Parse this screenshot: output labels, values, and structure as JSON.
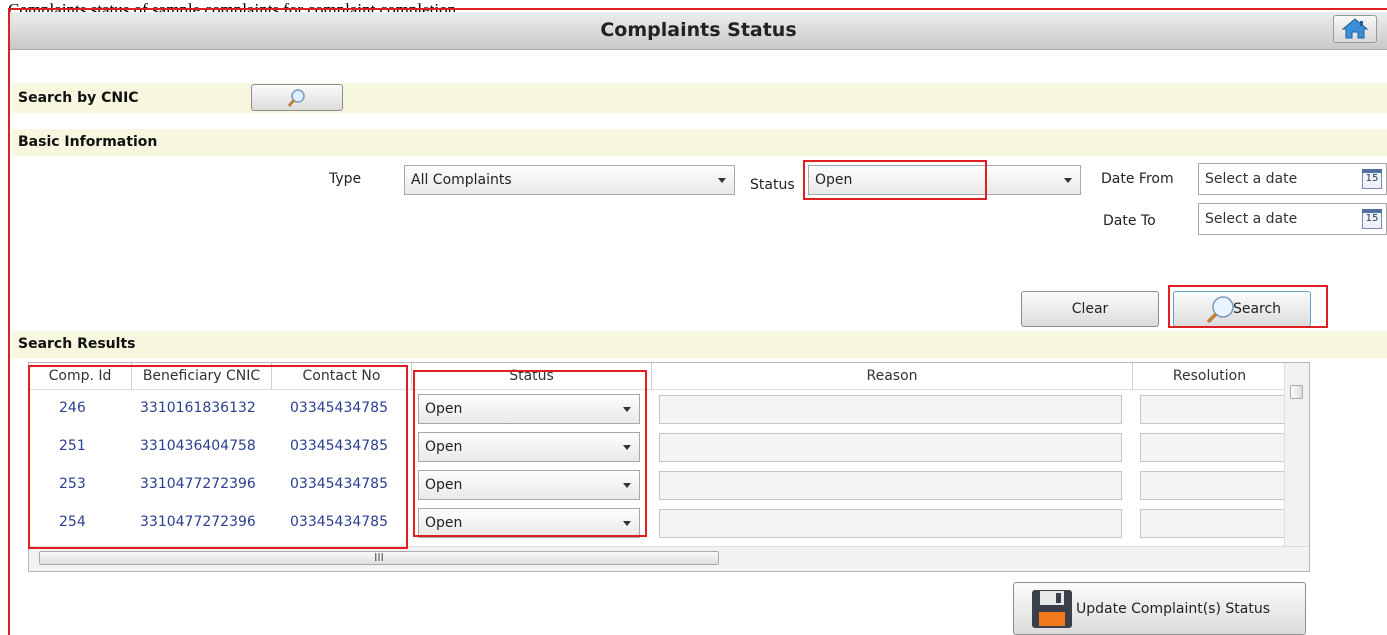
{
  "caption": "Complaints status of sample complaints for complaint completion",
  "window": {
    "title": "Complaints Status",
    "home_icon": "home-icon"
  },
  "search_cnic": {
    "label": "Search by CNIC",
    "icon": "magnifier-icon"
  },
  "basic_info": {
    "heading": "Basic Information",
    "type_label": "Type",
    "type_value": "All Complaints",
    "status_label": "Status",
    "status_value": "Open",
    "date_from_label": "Date From",
    "date_from_placeholder": "Select a date",
    "date_to_label": "Date To",
    "date_to_placeholder": "Select a date",
    "calendar_day": "15"
  },
  "actions": {
    "clear_label": "Clear",
    "search_label": "Search"
  },
  "results": {
    "heading": "Search Results",
    "columns": [
      "Comp. Id",
      "Beneficiary CNIC",
      "Contact No",
      "Status",
      "Reason",
      "Resolution"
    ],
    "rows": [
      {
        "id": "246",
        "cnic": "3310161836132",
        "contact": "03345434785",
        "status": "Open"
      },
      {
        "id": "251",
        "cnic": "3310436404758",
        "contact": "03345434785",
        "status": "Open"
      },
      {
        "id": "253",
        "cnic": "3310477272396",
        "contact": "03345434785",
        "status": "Open"
      },
      {
        "id": "254",
        "cnic": "3310477272396",
        "contact": "03345434785",
        "status": "Open"
      }
    ],
    "hscroll_grip": "III"
  },
  "update_button": {
    "label": "Update Complaint(s) Status",
    "icon": "floppy-disk-icon"
  },
  "colors": {
    "highlight": "#e02020",
    "section_band": "#f7f7df",
    "link_text": "#2a3f8f"
  }
}
